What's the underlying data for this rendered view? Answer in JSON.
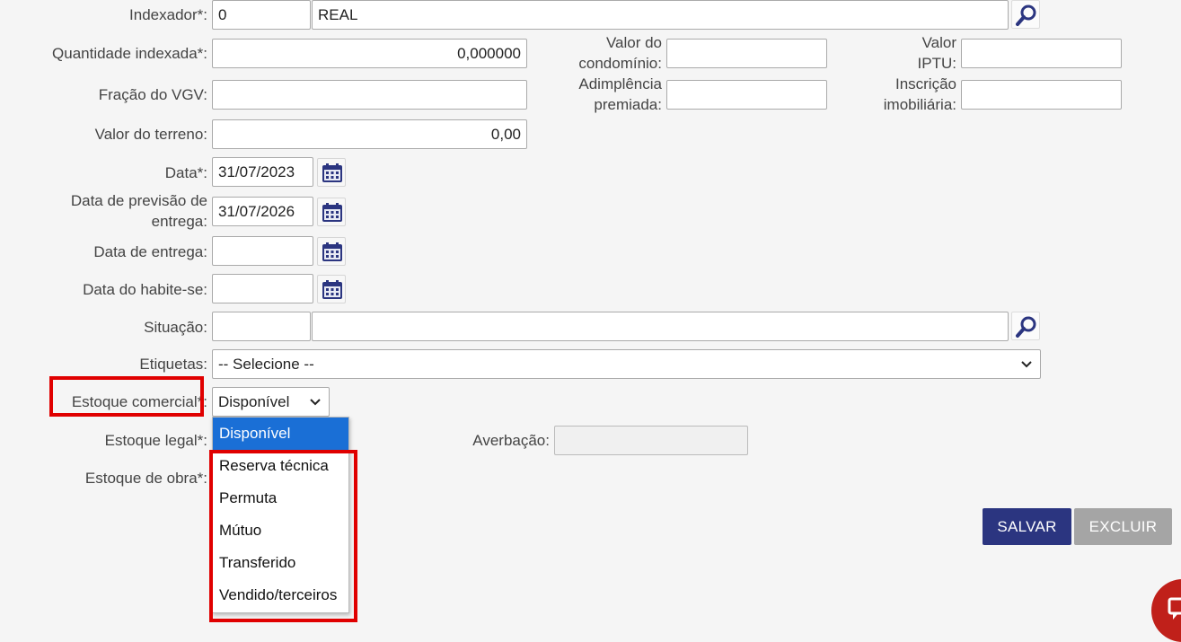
{
  "form": {
    "indexador": {
      "label": "Indexador*:",
      "code": "0",
      "name": "REAL"
    },
    "quantidade_indexada": {
      "label": "Quantidade indexada*:",
      "value": "0,000000"
    },
    "valor_condominio": {
      "label_line1": "Valor do",
      "label_line2": "condomínio:",
      "value": ""
    },
    "valor_iptu": {
      "label_line1": "Valor",
      "label_line2": "IPTU:",
      "value": ""
    },
    "fracao_vgv": {
      "label": "Fração do VGV:",
      "value": ""
    },
    "adimplencia_premiada": {
      "label_line1": "Adimplência",
      "label_line2": "premiada:",
      "value": ""
    },
    "inscricao_imobiliaria": {
      "label_line1": "Inscrição",
      "label_line2": "imobiliária:",
      "value": ""
    },
    "valor_terreno": {
      "label": "Valor do terreno:",
      "value": "0,00"
    },
    "data": {
      "label": "Data*:",
      "value": "31/07/2023"
    },
    "data_previsao_entrega": {
      "label_line1": "Data de previsão de",
      "label_line2": "entrega:",
      "value": "31/07/2026"
    },
    "data_entrega": {
      "label": "Data de entrega:",
      "value": ""
    },
    "data_habite_se": {
      "label": "Data do habite-se:",
      "value": ""
    },
    "situacao": {
      "label": "Situação:",
      "code": "",
      "name": ""
    },
    "etiquetas": {
      "label": "Etiquetas:",
      "value": "-- Selecione --"
    },
    "estoque_comercial": {
      "label": "Estoque comercial*:",
      "value": "Disponível"
    },
    "estoque_legal": {
      "label": "Estoque legal*:"
    },
    "averbacao": {
      "label": "Averbação:",
      "value": ""
    },
    "estoque_obra": {
      "label": "Estoque de obra*:"
    }
  },
  "dropdown": {
    "options": [
      "Disponível",
      "Reserva técnica",
      "Permuta",
      "Mútuo",
      "Transferido",
      "Vendido/terceiros"
    ],
    "selected_index": 0
  },
  "actions": {
    "save_label": "SALVAR",
    "delete_label": "EXCLUIR"
  },
  "colors": {
    "save_bg": "#2b3580",
    "delete_bg": "#a5a5a5",
    "highlight_border": "#e00000",
    "dropdown_selected": "#1a6fd6",
    "icon_blue": "#2b3580"
  },
  "icons": {
    "search": "magnifier-icon",
    "calendar": "calendar-icon",
    "chevron": "chevron-down-icon"
  }
}
